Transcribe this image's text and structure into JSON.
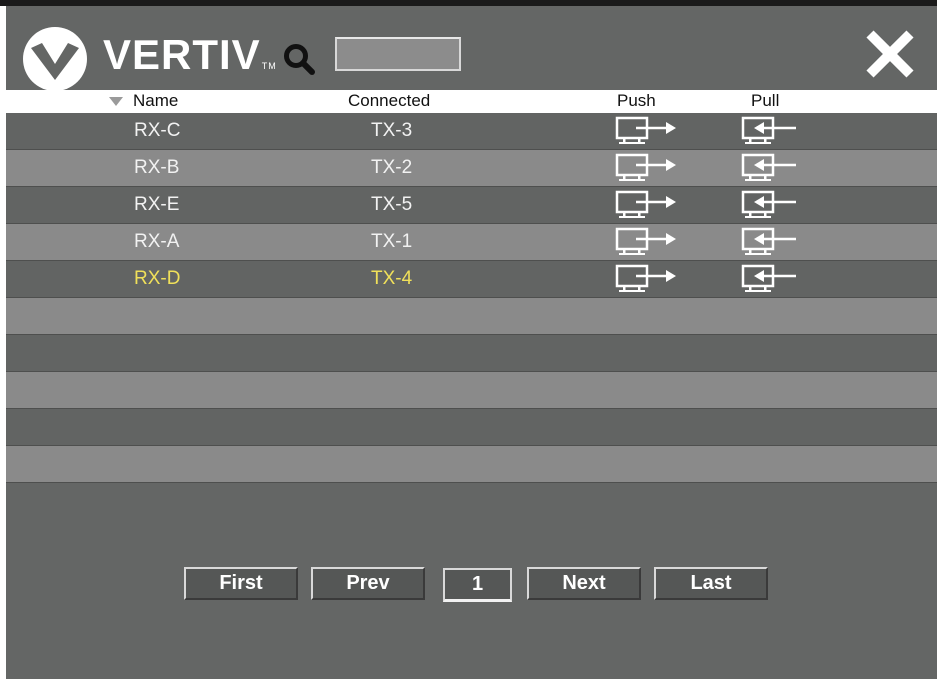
{
  "header": {
    "brand": "VERTIV",
    "trademark": "TM",
    "search": {
      "value": "",
      "placeholder": ""
    }
  },
  "table": {
    "columns": {
      "name": "Name",
      "connected": "Connected",
      "push": "Push",
      "pull": "Pull"
    },
    "sort": {
      "column": "name",
      "direction": "descending"
    },
    "rows": [
      {
        "name": "RX-C",
        "connected": "TX-3",
        "selected": false
      },
      {
        "name": "RX-B",
        "connected": "TX-2",
        "selected": false
      },
      {
        "name": "RX-E",
        "connected": "TX-5",
        "selected": false
      },
      {
        "name": "RX-A",
        "connected": "TX-1",
        "selected": false
      },
      {
        "name": "RX-D",
        "connected": "TX-4",
        "selected": true
      }
    ],
    "selected_color": "#f0e05a"
  },
  "pagination": {
    "first": "First",
    "prev": "Prev",
    "page": "1",
    "next": "Next",
    "last": "Last"
  },
  "icons": {
    "logo": "vertiv-logo-icon",
    "search": "search-icon",
    "close": "close-icon",
    "push": "push-monitor-icon",
    "pull": "pull-monitor-icon",
    "sort": "sort-down-icon"
  }
}
